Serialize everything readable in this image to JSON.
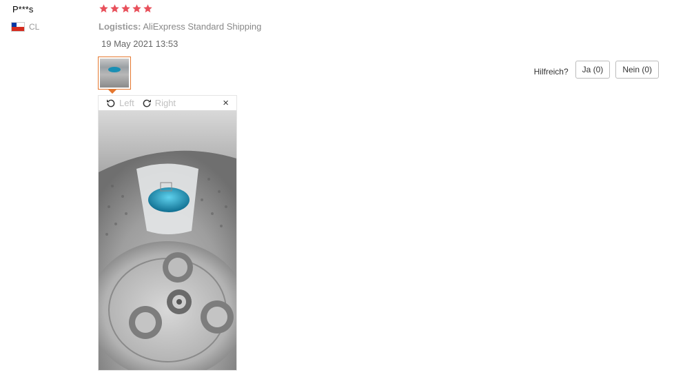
{
  "review": {
    "user_name": "P***s",
    "country_code": "CL",
    "rating": 5,
    "logistics_label": "Logistics:",
    "logistics_value": "AliExpress Standard Shipping",
    "date": "19 May 2021 13:53"
  },
  "viewer": {
    "rotate_left_label": "Left",
    "rotate_right_label": "Right",
    "close_glyph": "×"
  },
  "helpful": {
    "question": "Hilfreich?",
    "yes_label": "Ja (0)",
    "no_label": "Nein (0)"
  },
  "colors": {
    "star": "#e8505b",
    "thumb_border": "#e5772f"
  }
}
